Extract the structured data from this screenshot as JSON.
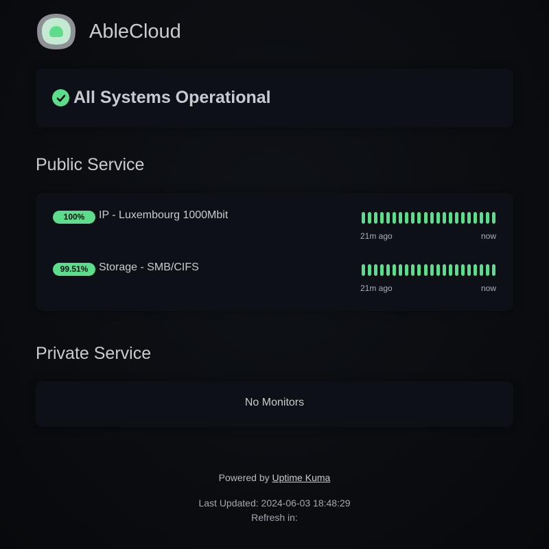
{
  "header": {
    "title": "AbleCloud",
    "logo_icon": "cloud-logo-icon"
  },
  "status": {
    "icon": "check-circle-icon",
    "text": "All Systems Operational",
    "color": "#5cdd8b"
  },
  "public_section": {
    "title": "Public Service",
    "monitors": [
      {
        "uptime": "100%",
        "name": "IP - Luxembourg 1000Mbit",
        "beats_up": 22,
        "start_label": "21m ago",
        "end_label": "now"
      },
      {
        "uptime": "99.51%",
        "name": "Storage - SMB/CIFS",
        "beats_up": 22,
        "start_label": "21m ago",
        "end_label": "now"
      }
    ]
  },
  "private_section": {
    "title": "Private Service",
    "empty_text": "No Monitors"
  },
  "footer": {
    "powered_prefix": "Powered by",
    "powered_link": "Uptime Kuma",
    "last_updated": "Last Updated: 2024-06-03 18:48:29",
    "refresh": "Refresh in:"
  },
  "colors": {
    "up": "#5cdd8b",
    "background": "#0b0d11",
    "card": "#0d1016"
  }
}
